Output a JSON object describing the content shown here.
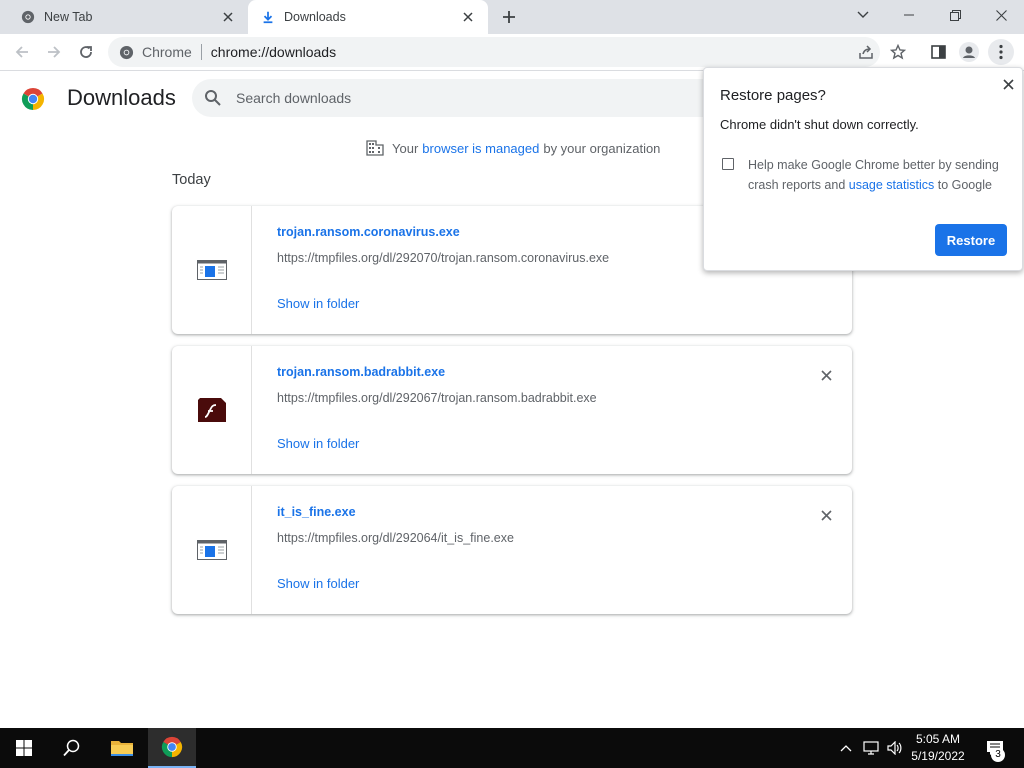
{
  "browser": {
    "tabs": [
      {
        "label": "New Tab",
        "active": false
      },
      {
        "label": "Downloads",
        "active": true
      }
    ],
    "omnibox": {
      "site_label": "Chrome",
      "url": "chrome://downloads"
    }
  },
  "downloads_page": {
    "title": "Downloads",
    "search_placeholder": "Search downloads",
    "managed_notice": {
      "prefix": "Your",
      "link": "browser is managed",
      "suffix": "by your organization"
    },
    "section_label": "Today",
    "items": [
      {
        "filename": "trojan.ransom.coronavirus.exe",
        "url": "https://tmpfiles.org/dl/292070/trojan.ransom.coronavirus.exe",
        "action": "Show in folder",
        "icon": "window-exe-icon"
      },
      {
        "filename": "trojan.ransom.badrabbit.exe",
        "url": "https://tmpfiles.org/dl/292067/trojan.ransom.badrabbit.exe",
        "action": "Show in folder",
        "icon": "flash-installer-icon"
      },
      {
        "filename": "it_is_fine.exe",
        "url": "https://tmpfiles.org/dl/292064/it_is_fine.exe",
        "action": "Show in folder",
        "icon": "window-exe-icon"
      }
    ]
  },
  "restore_bubble": {
    "title": "Restore pages?",
    "message": "Chrome didn't shut down correctly.",
    "checkbox_prefix": "Help make Google Chrome better by sending crash reports and",
    "checkbox_link": "usage statistics",
    "checkbox_suffix": "to Google",
    "checked": false,
    "button": "Restore"
  },
  "taskbar": {
    "time": "5:05 AM",
    "date": "5/19/2022",
    "notification_count": "3"
  },
  "colors": {
    "accent": "#1a73e8",
    "tabstrip": "#dee1e6",
    "taskbar": "#0b0b0b"
  }
}
